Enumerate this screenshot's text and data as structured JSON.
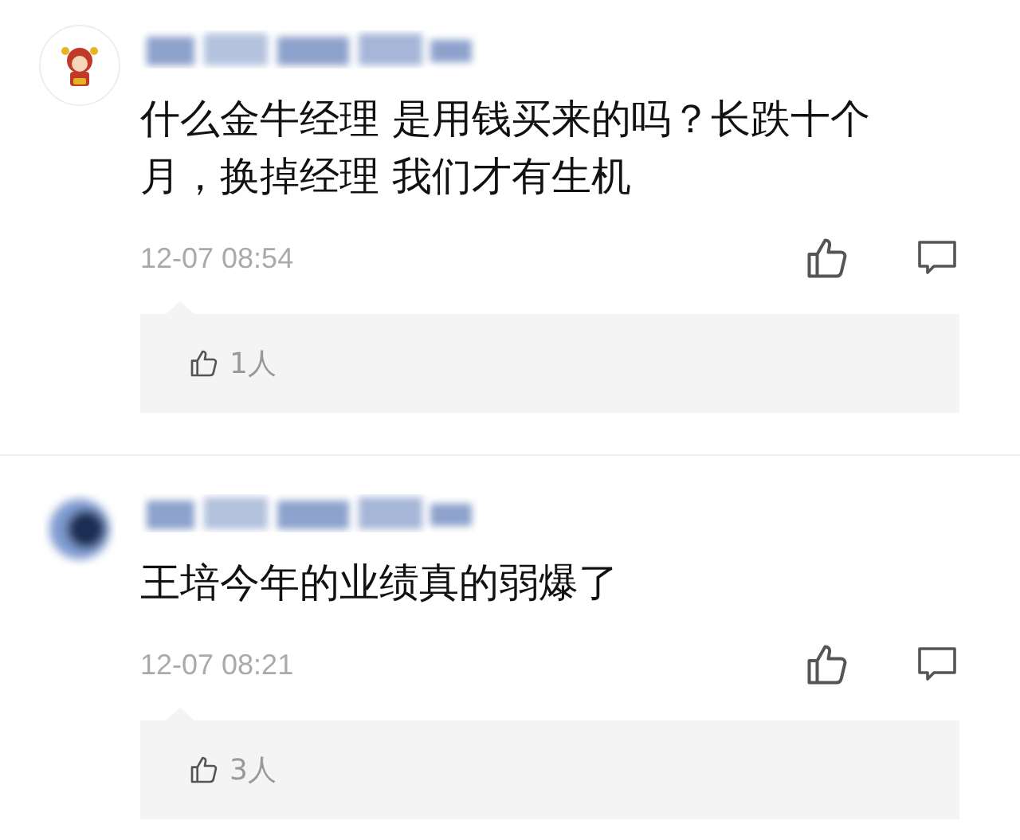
{
  "comments": [
    {
      "avatar": {
        "kind": "cartoon"
      },
      "text": "什么金牛经理 是用钱买来的吗？长跌十个月，换掉经理 我们才有生机",
      "time": "12-07 08:54",
      "likes": "1人"
    },
    {
      "avatar": {
        "kind": "blurred"
      },
      "text": "王培今年的业绩真的弱爆了",
      "time": "12-07 08:21",
      "likes": "3人"
    }
  ]
}
